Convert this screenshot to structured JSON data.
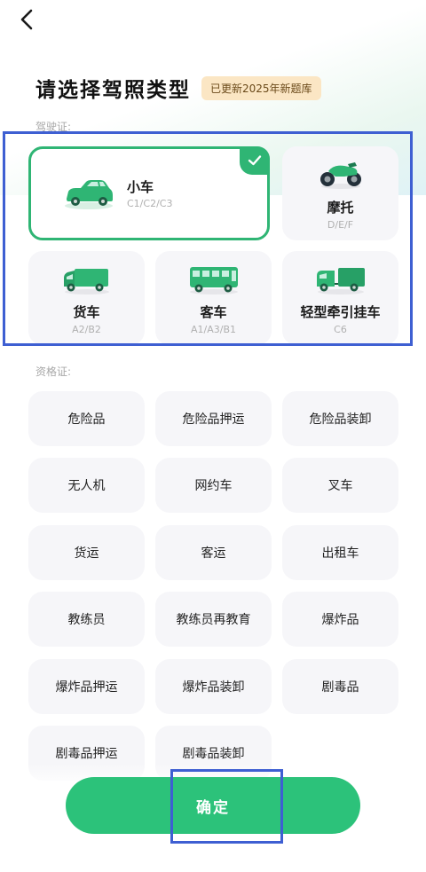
{
  "header": {
    "title": "请选择驾照类型",
    "badge": "已更新2025年新题库"
  },
  "sections": {
    "license_label": "驾驶证:",
    "qualification_label": "资格证:"
  },
  "licenses": [
    {
      "name": "小车",
      "sub": "C1/C2/C3",
      "icon": "car-icon",
      "selected": true
    },
    {
      "name": "摩托",
      "sub": "D/E/F",
      "icon": "motorcycle-icon",
      "selected": false
    },
    {
      "name": "货车",
      "sub": "A2/B2",
      "icon": "truck-icon",
      "selected": false
    },
    {
      "name": "客车",
      "sub": "A1/A3/B1",
      "icon": "bus-icon",
      "selected": false
    },
    {
      "name": "轻型牵引挂车",
      "sub": "C6",
      "icon": "trailer-icon",
      "selected": false
    }
  ],
  "qualifications": [
    "危险品",
    "危险品押运",
    "危险品装卸",
    "无人机",
    "网约车",
    "叉车",
    "货运",
    "客运",
    "出租车",
    "教练员",
    "教练员再教育",
    "爆炸品",
    "爆炸品押运",
    "爆炸品装卸",
    "剧毒品",
    "剧毒品押运",
    "剧毒品装卸"
  ],
  "actions": {
    "confirm_label": "确定"
  },
  "colors": {
    "accent": "#2cc27a",
    "selected_border": "#2fb574",
    "card_bg": "#f6f6f9",
    "badge_bg": "#fbe6c4",
    "annotation_box": "#3e5fd2"
  },
  "icons": {
    "back": "chevron-left-icon",
    "check": "check-icon"
  }
}
